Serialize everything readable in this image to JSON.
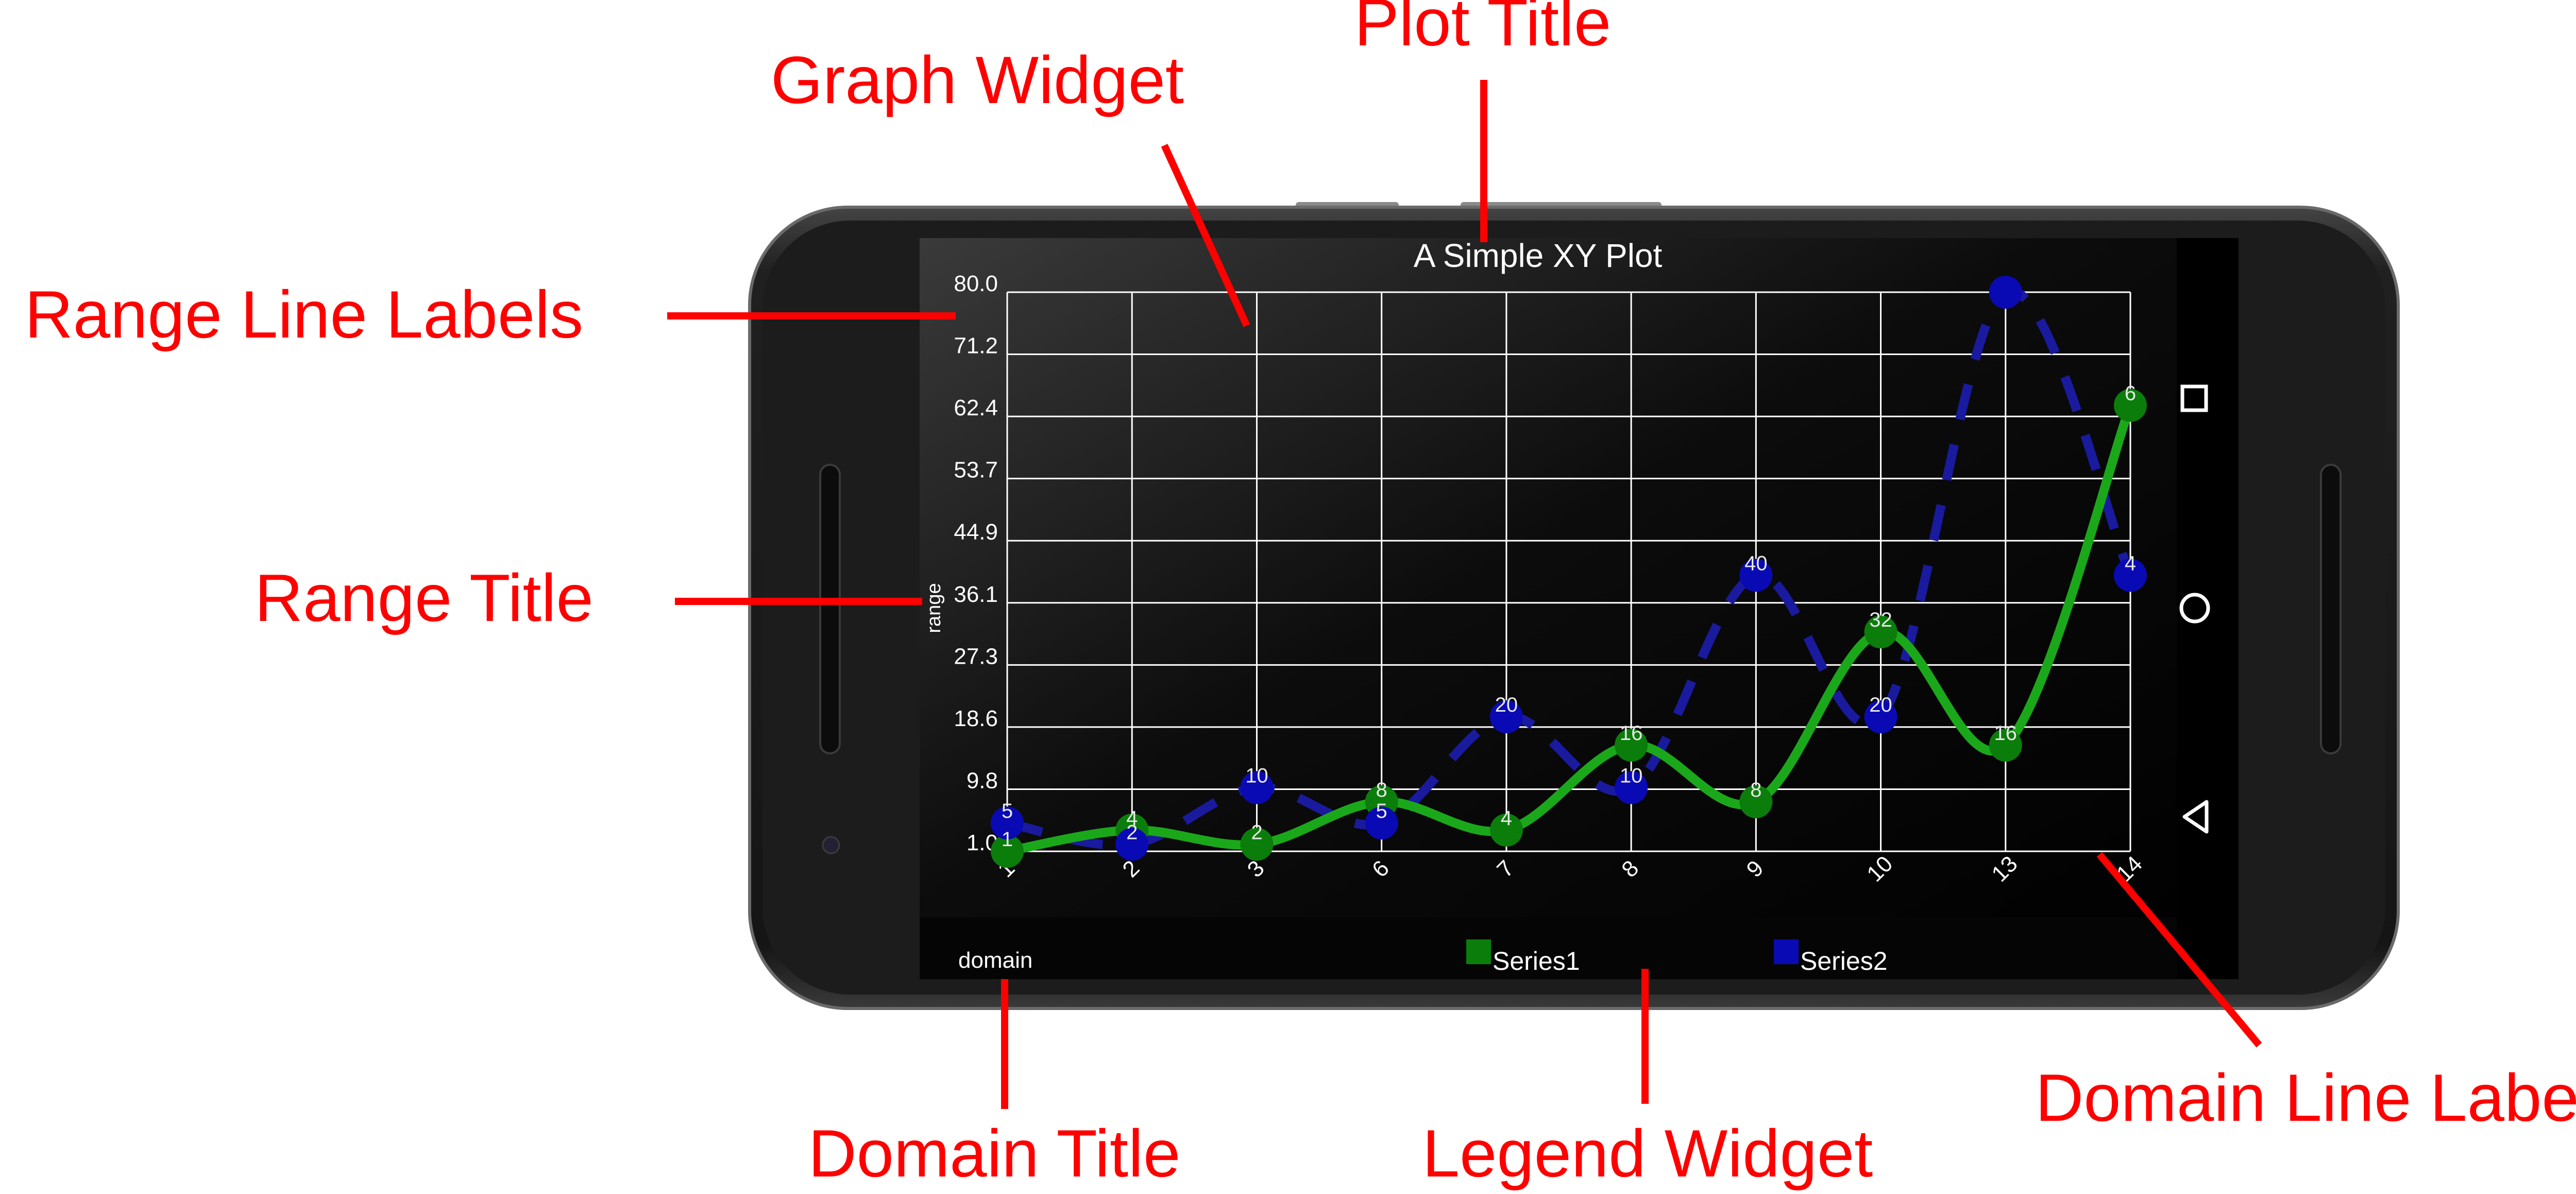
{
  "colors": {
    "annotation": "#ff0000",
    "phone_body": "#1b1b1b",
    "screen_bg": "#000000",
    "grid": "#ffffff",
    "series1": "#1aa81a",
    "series2": "#1a1a9e",
    "series1_marker": "#0b7d0b",
    "series2_marker": "#0a0ab4",
    "label_text": "#ffffff"
  },
  "annotations": {
    "plot_title": "Plot Title",
    "graph_widget": "Graph Widget",
    "range_line_labels": "Range Line Labels",
    "range_title": "Range Title",
    "domain_title": "Domain Title",
    "legend_widget": "Legend Widget",
    "domain_line_labels": "Domain Line Labels"
  },
  "nav": {
    "recent_icon": "square-icon",
    "home_icon": "circle-icon",
    "back_icon": "triangle-back-icon"
  },
  "chart_data": {
    "type": "line",
    "title": "A Simple XY Plot",
    "xlabel": "domain",
    "ylabel": "range",
    "categories": [
      "1",
      "2",
      "3",
      "6",
      "7",
      "8",
      "9",
      "10",
      "13",
      "14"
    ],
    "ylim": [
      1.0,
      80.0
    ],
    "y_ticks": [
      "1.0",
      "9.8",
      "18.6",
      "27.3",
      "36.1",
      "44.9",
      "53.7",
      "62.4",
      "71.2",
      "80.0"
    ],
    "grid": true,
    "legend": "bottom-center",
    "series": [
      {
        "name": "Series1",
        "style": "solid smooth",
        "values": [
          1,
          4,
          2,
          8,
          4,
          16,
          8,
          32,
          16,
          64
        ],
        "labels": [
          "1",
          "4",
          "2",
          "8",
          "4",
          "16",
          "8",
          "32",
          "16",
          "6"
        ]
      },
      {
        "name": "Series2",
        "style": "dashed smooth",
        "values": [
          5,
          2,
          10,
          5,
          20,
          10,
          40,
          20,
          80,
          40
        ],
        "labels": [
          "5",
          "2",
          "10",
          "5",
          "20",
          "10",
          "40",
          "20",
          "",
          "4"
        ]
      }
    ]
  }
}
